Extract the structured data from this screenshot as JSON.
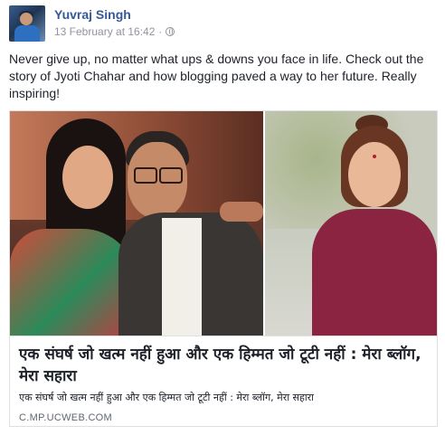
{
  "post": {
    "author": "Yuvraj Singh",
    "timestamp": "13 February at 16:42",
    "separator": "·",
    "text": "Never give up, no matter what ups & downs you face in life. Check out the story of Jyoti Chahar and how blogging paved a way to her future. Really inspiring!"
  },
  "link_card": {
    "title": "एक संघर्ष जो खत्म नहीं हुआ और एक हिम्मत जो टूटी नहीं : मेरा ब्लॉग, मेरा सहारा",
    "description": "एक संघर्ष जो खत्म नहीं हुआ और एक हिम्मत जो टूटी नहीं : मेरा ब्लॉग, मेरा सहारा",
    "domain": "C.MP.UCWEB.COM"
  },
  "colors": {
    "author_link": "#365899",
    "meta_text": "#90949c",
    "body_text": "#1d2129",
    "card_border": "#dddfe2"
  },
  "icons": {
    "privacy": "globe-icon"
  }
}
